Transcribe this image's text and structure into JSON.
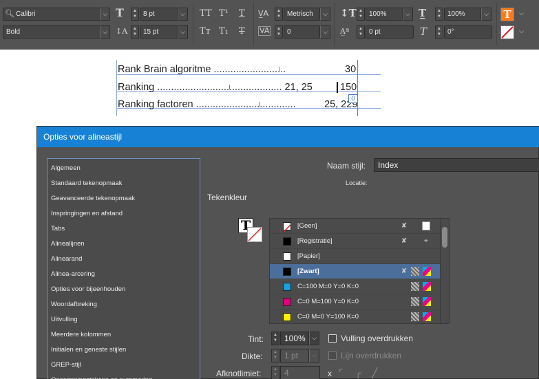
{
  "control_bar": {
    "font_family": "Calibri",
    "font_style": "Bold",
    "font_size": "8 pt",
    "leading": "15 pt",
    "kerning": "Metrisch",
    "tracking": "0",
    "vertical_scale": "100%",
    "horizontal_scale": "100%",
    "baseline_shift": "0 pt",
    "skew": "0°",
    "caps_icons": [
      "TT",
      "T¹",
      "T",
      "Tт",
      "T₁",
      "T"
    ],
    "icons": [
      "search-icon",
      "font-size-icon",
      "leading-icon",
      "kerning-icon",
      "tracking-icon",
      "vertical-scale-icon",
      "horizontal-scale-icon",
      "baseline-shift-icon",
      "skew-icon",
      "fill-color-icon",
      "stroke-color-icon"
    ],
    "accent_color": "#ff7a1a"
  },
  "document": {
    "lines": [
      {
        "text": "Rank Brain algoritme ..........................",
        "page": "30"
      },
      {
        "text": "Ranking ............................................. 21, 25",
        "page": "150"
      },
      {
        "text": "Ranking factoren ....................................",
        "page": "25, 229"
      }
    ],
    "overflow_marker": "0"
  },
  "dialog": {
    "title": "Opties voor alineastijl",
    "style_name_label": "Naam stijl:",
    "style_name_value": "Index",
    "location_label": "Locatie:",
    "section_title": "Tekenkleur",
    "nav_items": [
      "Algemeen",
      "Standaard tekenopmaak",
      "Geavanceerde tekenopmaak",
      "Inspringingen en afstand",
      "Tabs",
      "Alinealijnen",
      "Alinearand",
      "Alinea-arcering",
      "Opties voor bijeenhouden",
      "Woordafbreking",
      "Uitvulling",
      "Meerdere kolommen",
      "Initialen en geneste stijlen",
      "GREP-stijl",
      "Opsommingstekens en nummering"
    ],
    "swatches": [
      {
        "name": "[Geen]",
        "color": "none",
        "selected": false
      },
      {
        "name": "[Registratie]",
        "color": "#000000",
        "selected": false
      },
      {
        "name": "[Papier]",
        "color": "#ffffff",
        "selected": false
      },
      {
        "name": "[Zwart]",
        "color": "#000000",
        "selected": true
      },
      {
        "name": "C=100 M=0 Y=0 K=0",
        "color": "#1aa0dc",
        "selected": false
      },
      {
        "name": "C=0 M=100 Y=0 K=0",
        "color": "#e4007c",
        "selected": false
      },
      {
        "name": "C=0 M=0 Y=100 K=0",
        "color": "#fff200",
        "selected": false
      }
    ],
    "tint_label": "Tint:",
    "tint_value": "100%",
    "overprint_fill_label": "Vulling overdrukken",
    "weight_label": "Dikte:",
    "weight_value": "1 pt",
    "overprint_stroke_label": "Lijn overdrukken",
    "miter_label": "Afknotlimiet:",
    "miter_value": "4",
    "miter_x": "x"
  }
}
